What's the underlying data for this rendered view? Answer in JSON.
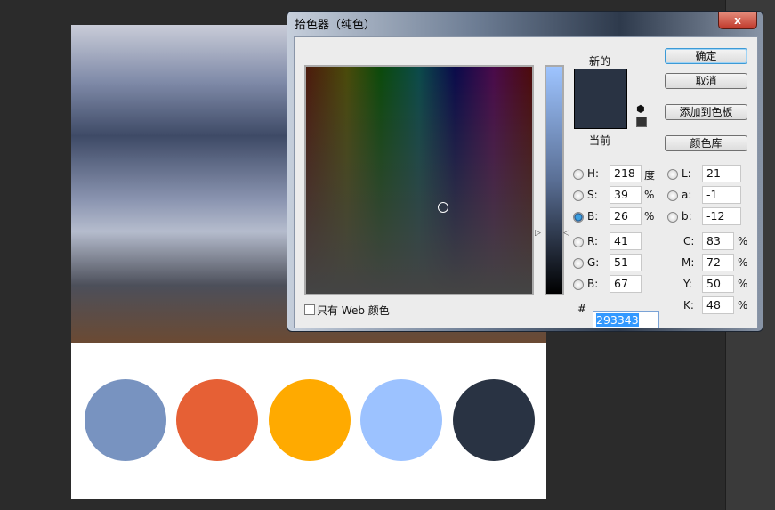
{
  "dialog": {
    "title": "拾色器（纯色）",
    "close": "x",
    "new_label": "新的",
    "current_label": "当前",
    "buttons": {
      "ok": "确定",
      "cancel": "取消",
      "add_swatch": "添加到色板",
      "libraries": "颜色库"
    },
    "web_only": "只有 Web 颜色",
    "fields": {
      "H": {
        "label": "H:",
        "value": "218",
        "unit": "度"
      },
      "S": {
        "label": "S:",
        "value": "39",
        "unit": "%"
      },
      "Bv": {
        "label": "B:",
        "value": "26",
        "unit": "%"
      },
      "R": {
        "label": "R:",
        "value": "41"
      },
      "G": {
        "label": "G:",
        "value": "51"
      },
      "Bc": {
        "label": "B:",
        "value": "67"
      },
      "L": {
        "label": "L:",
        "value": "21"
      },
      "a": {
        "label": "a:",
        "value": "-1"
      },
      "b": {
        "label": "b:",
        "value": "-12"
      },
      "C": {
        "label": "C:",
        "value": "83",
        "unit": "%"
      },
      "M": {
        "label": "M:",
        "value": "72",
        "unit": "%"
      },
      "Y": {
        "label": "Y:",
        "value": "50",
        "unit": "%"
      },
      "K": {
        "label": "K:",
        "value": "48",
        "unit": "%"
      }
    },
    "hex_label": "#",
    "hex": "293343",
    "new_color": "#293343",
    "current_color": "#293343"
  },
  "swatches": [
    "#7893c0",
    "#e66035",
    "#ffaa00",
    "#9cc2ff",
    "#293343"
  ]
}
